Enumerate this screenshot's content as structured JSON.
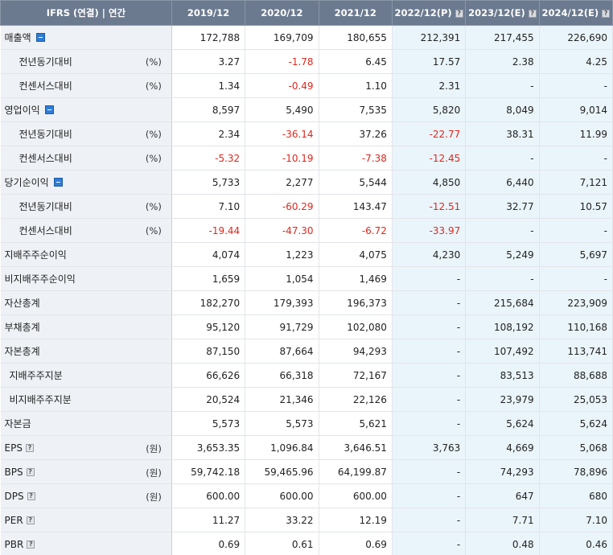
{
  "header": {
    "title": "IFRS (연결) | 연간",
    "periods": [
      {
        "label": "2019/12",
        "estimate": false,
        "info": false
      },
      {
        "label": "2020/12",
        "estimate": false,
        "info": false
      },
      {
        "label": "2021/12",
        "estimate": false,
        "info": false
      },
      {
        "label": "2022/12(P)",
        "estimate": true,
        "info": true
      },
      {
        "label": "2023/12(E)",
        "estimate": true,
        "info": true
      },
      {
        "label": "2024/12(E)",
        "estimate": true,
        "info": true
      }
    ]
  },
  "rows": [
    {
      "label": "매출액",
      "level": 0,
      "toggle": true,
      "info": false,
      "unit": "",
      "values": [
        "172,788",
        "169,709",
        "180,655",
        "212,391",
        "217,455",
        "226,690"
      ]
    },
    {
      "label": "전년동기대비",
      "level": 1,
      "toggle": false,
      "info": false,
      "unit": "(%)",
      "values": [
        "3.27",
        "-1.78",
        "6.45",
        "17.57",
        "2.38",
        "4.25"
      ]
    },
    {
      "label": "컨센서스대비",
      "level": 1,
      "toggle": false,
      "info": false,
      "unit": "(%)",
      "values": [
        "1.34",
        "-0.49",
        "1.10",
        "2.31",
        "-",
        "-"
      ]
    },
    {
      "label": "영업이익",
      "level": 0,
      "toggle": true,
      "info": false,
      "unit": "",
      "values": [
        "8,597",
        "5,490",
        "7,535",
        "5,820",
        "8,049",
        "9,014"
      ]
    },
    {
      "label": "전년동기대비",
      "level": 1,
      "toggle": false,
      "info": false,
      "unit": "(%)",
      "values": [
        "2.34",
        "-36.14",
        "37.26",
        "-22.77",
        "38.31",
        "11.99"
      ]
    },
    {
      "label": "컨센서스대비",
      "level": 1,
      "toggle": false,
      "info": false,
      "unit": "(%)",
      "values": [
        "-5.32",
        "-10.19",
        "-7.38",
        "-12.45",
        "-",
        "-"
      ]
    },
    {
      "label": "당기순이익",
      "level": 0,
      "toggle": true,
      "info": false,
      "unit": "",
      "values": [
        "5,733",
        "2,277",
        "5,544",
        "4,850",
        "6,440",
        "7,121"
      ]
    },
    {
      "label": "전년동기대비",
      "level": 1,
      "toggle": false,
      "info": false,
      "unit": "(%)",
      "values": [
        "7.10",
        "-60.29",
        "143.47",
        "-12.51",
        "32.77",
        "10.57"
      ]
    },
    {
      "label": "컨센서스대비",
      "level": 1,
      "toggle": false,
      "info": false,
      "unit": "(%)",
      "values": [
        "-19.44",
        "-47.30",
        "-6.72",
        "-33.97",
        "-",
        "-"
      ]
    },
    {
      "label": "지배주주순이익",
      "level": 0,
      "toggle": false,
      "info": false,
      "unit": "",
      "values": [
        "4,074",
        "1,223",
        "4,075",
        "4,230",
        "5,249",
        "5,697"
      ]
    },
    {
      "label": "비지배주주순이익",
      "level": 0,
      "toggle": false,
      "info": false,
      "unit": "",
      "values": [
        "1,659",
        "1,054",
        "1,469",
        "-",
        "-",
        "-"
      ]
    },
    {
      "label": "자산총계",
      "level": 0,
      "toggle": false,
      "info": false,
      "unit": "",
      "values": [
        "182,270",
        "179,393",
        "196,373",
        "-",
        "215,684",
        "223,909"
      ]
    },
    {
      "label": "부채총계",
      "level": 0,
      "toggle": false,
      "info": false,
      "unit": "",
      "values": [
        "95,120",
        "91,729",
        "102,080",
        "-",
        "108,192",
        "110,168"
      ]
    },
    {
      "label": "자본총계",
      "level": 0,
      "toggle": false,
      "info": false,
      "unit": "",
      "values": [
        "87,150",
        "87,664",
        "94,293",
        "-",
        "107,492",
        "113,741"
      ]
    },
    {
      "label": "지배주주지분",
      "level": 2,
      "toggle": false,
      "info": false,
      "unit": "",
      "values": [
        "66,626",
        "66,318",
        "72,167",
        "-",
        "83,513",
        "88,688"
      ]
    },
    {
      "label": "비지배주주지분",
      "level": 2,
      "toggle": false,
      "info": false,
      "unit": "",
      "values": [
        "20,524",
        "21,346",
        "22,126",
        "-",
        "23,979",
        "25,053"
      ]
    },
    {
      "label": "자본금",
      "level": 0,
      "toggle": false,
      "info": false,
      "unit": "",
      "values": [
        "5,573",
        "5,573",
        "5,621",
        "-",
        "5,624",
        "5,624"
      ]
    },
    {
      "label": "EPS",
      "level": 0,
      "toggle": false,
      "info": true,
      "unit": "(원)",
      "values": [
        "3,653.35",
        "1,096.84",
        "3,646.51",
        "3,763",
        "4,669",
        "5,068"
      ]
    },
    {
      "label": "BPS",
      "level": 0,
      "toggle": false,
      "info": true,
      "unit": "(원)",
      "values": [
        "59,742.18",
        "59,465.96",
        "64,199.87",
        "-",
        "74,293",
        "78,896"
      ]
    },
    {
      "label": "DPS",
      "level": 0,
      "toggle": false,
      "info": true,
      "unit": "(원)",
      "values": [
        "600.00",
        "600.00",
        "600.00",
        "-",
        "647",
        "680"
      ]
    },
    {
      "label": "PER",
      "level": 0,
      "toggle": false,
      "info": true,
      "unit": "",
      "values": [
        "11.27",
        "33.22",
        "12.19",
        "-",
        "7.71",
        "7.10"
      ]
    },
    {
      "label": "PBR",
      "level": 0,
      "toggle": false,
      "info": true,
      "unit": "",
      "values": [
        "0.69",
        "0.61",
        "0.69",
        "-",
        "0.48",
        "0.46"
      ]
    }
  ]
}
